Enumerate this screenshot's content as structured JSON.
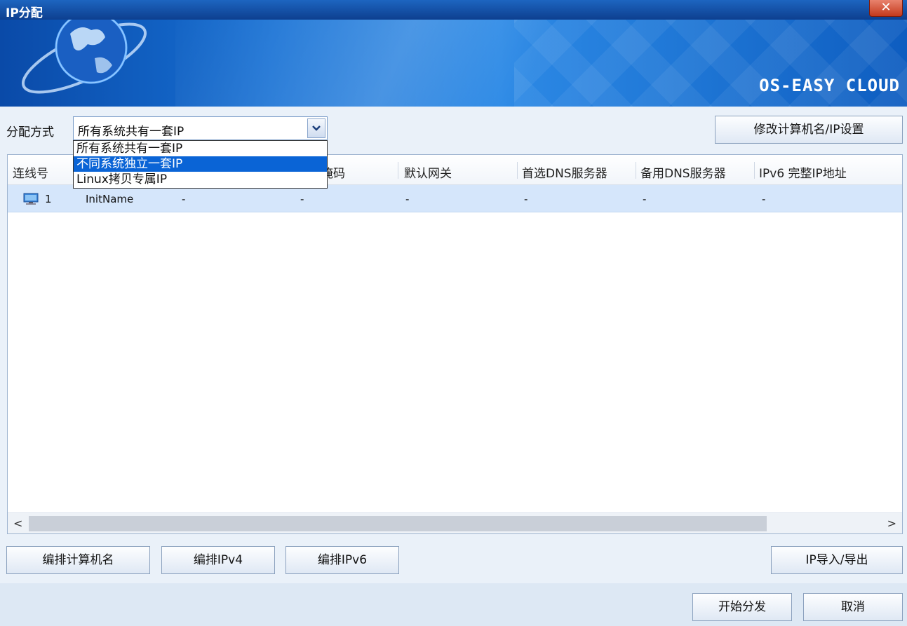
{
  "window": {
    "title": "IP分配",
    "close_label": "✕"
  },
  "banner": {
    "brand": "OS-EASY CLOUD"
  },
  "allocation": {
    "label": "分配方式",
    "selected": "所有系统共有一套IP",
    "options": [
      "所有系统共有一套IP",
      "不同系统独立一套IP",
      "Linux拷贝专属IP"
    ],
    "highlighted_option": "不同系统独立一套IP"
  },
  "toolbar": {
    "modify_label": "修改计算机名/IP设置"
  },
  "table": {
    "columns": [
      "连线号",
      "掩码",
      "默认网关",
      "首选DNS服务器",
      "备用DNS服务器",
      "IPv6 完整IP地址"
    ],
    "rows": [
      {
        "id": "1",
        "name": "InitName",
        "mask": "-",
        "col3": "-",
        "gateway": "-",
        "dns1": "-",
        "dns2": "-",
        "ipv6": "-"
      }
    ]
  },
  "actions": {
    "edit_names": "编排计算机名",
    "edit_ipv4": "编排IPv4",
    "edit_ipv6": "编排IPv6",
    "import_export": "IP导入/导出",
    "start": "开始分发",
    "cancel": "取消"
  },
  "colors": {
    "titlebar": "#0d3f8f",
    "selected_row": "#d5e6fb",
    "dropdown_highlight": "#0a64d6",
    "close": "#c4391c"
  },
  "icons": {
    "row_icon": "computer-icon",
    "dropdown": "chevron-down-icon",
    "scroll_left": "chevron-left-icon",
    "scroll_right": "chevron-right-icon",
    "brand_image": "globe-icon"
  }
}
